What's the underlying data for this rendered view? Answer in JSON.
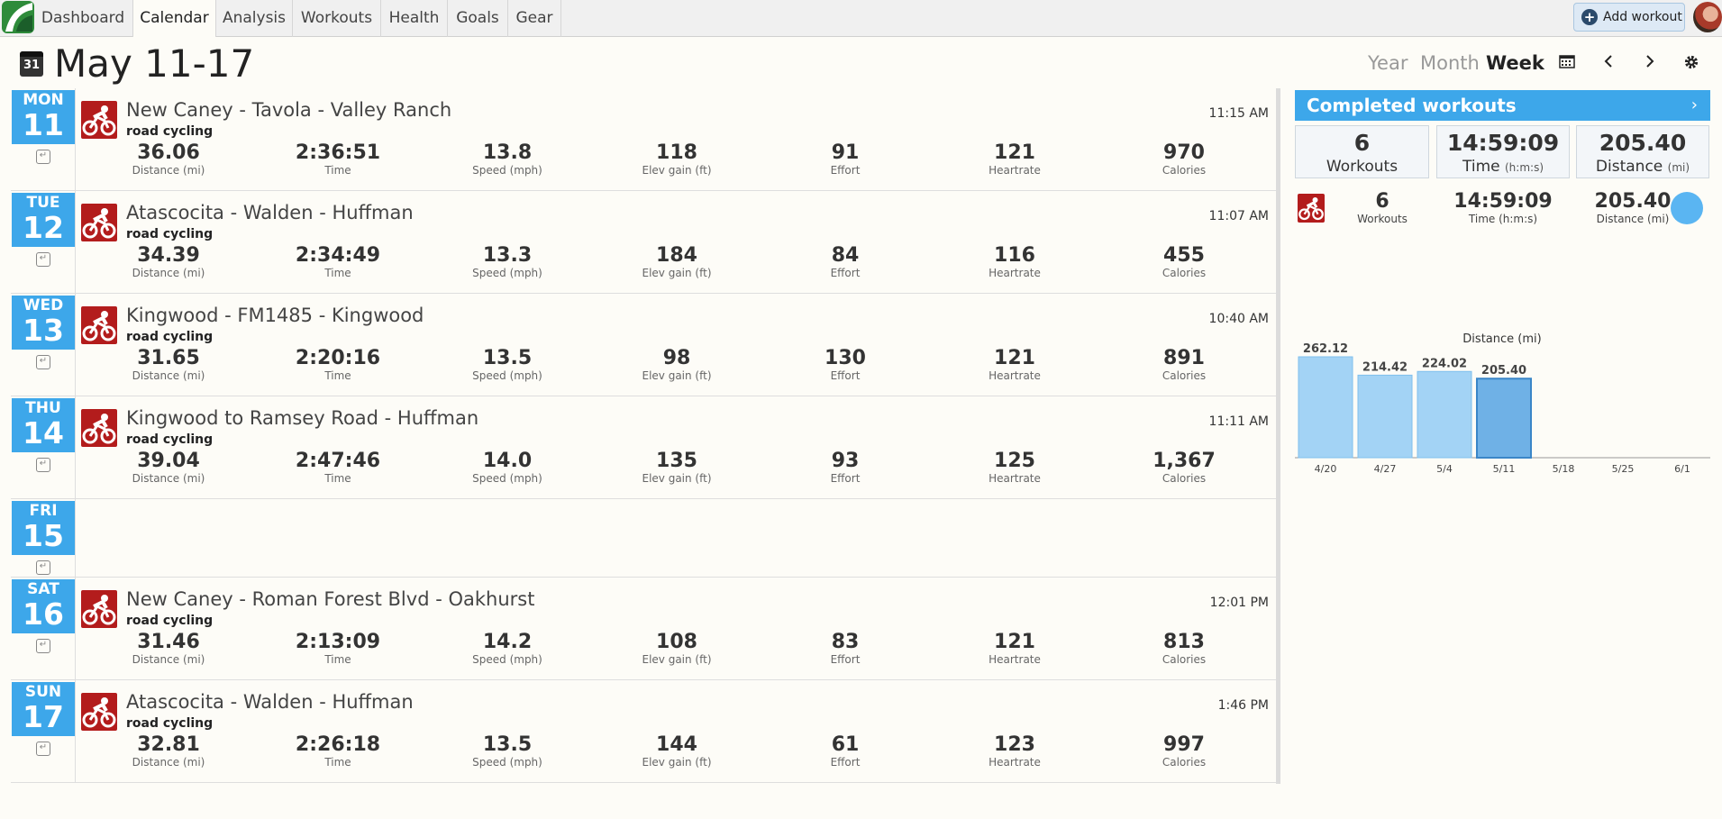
{
  "nav": {
    "tabs": [
      "Dashboard",
      "Calendar",
      "Analysis",
      "Workouts",
      "Health",
      "Goals",
      "Gear"
    ],
    "active": "Calendar",
    "add_workout": "Add workout"
  },
  "header": {
    "calendar_icon_text": "31",
    "title": "May 11-17",
    "views": [
      "Year",
      "Month",
      "Week"
    ],
    "active_view": "Week"
  },
  "icons": {
    "calendar_picker": "calendar-grid-icon",
    "prev": "chevron-left-icon",
    "next": "chevron-right-icon",
    "settings": "gear-icon",
    "workout_type": "road-cycling-icon",
    "day_add": "shoe-icon"
  },
  "colors": {
    "accent": "#3da7ea",
    "cycling": "#b31c1c",
    "bar": "#a3d3f5",
    "bar_current": "#6fb1e6"
  },
  "days": [
    {
      "dow": "MON",
      "num": "11",
      "workout": {
        "title": "New Caney - Tavola - Valley Ranch",
        "time_of_day": "11:15 AM",
        "type": "road cycling",
        "stats": [
          {
            "value": "36.06",
            "label": "Distance (mi)"
          },
          {
            "value": "2:36:51",
            "label": "Time"
          },
          {
            "value": "13.8",
            "label": "Speed (mph)"
          },
          {
            "value": "118",
            "label": "Elev gain (ft)"
          },
          {
            "value": "91",
            "label": "Effort"
          },
          {
            "value": "121",
            "label": "Heartrate"
          },
          {
            "value": "970",
            "label": "Calories"
          }
        ]
      }
    },
    {
      "dow": "TUE",
      "num": "12",
      "workout": {
        "title": "Atascocita - Walden - Huffman",
        "time_of_day": "11:07 AM",
        "type": "road cycling",
        "stats": [
          {
            "value": "34.39",
            "label": "Distance (mi)"
          },
          {
            "value": "2:34:49",
            "label": "Time"
          },
          {
            "value": "13.3",
            "label": "Speed (mph)"
          },
          {
            "value": "184",
            "label": "Elev gain (ft)"
          },
          {
            "value": "84",
            "label": "Effort"
          },
          {
            "value": "116",
            "label": "Heartrate"
          },
          {
            "value": "455",
            "label": "Calories"
          }
        ]
      }
    },
    {
      "dow": "WED",
      "num": "13",
      "workout": {
        "title": "Kingwood - FM1485 - Kingwood",
        "time_of_day": "10:40 AM",
        "type": "road cycling",
        "stats": [
          {
            "value": "31.65",
            "label": "Distance (mi)"
          },
          {
            "value": "2:20:16",
            "label": "Time"
          },
          {
            "value": "13.5",
            "label": "Speed (mph)"
          },
          {
            "value": "98",
            "label": "Elev gain (ft)"
          },
          {
            "value": "130",
            "label": "Effort"
          },
          {
            "value": "121",
            "label": "Heartrate"
          },
          {
            "value": "891",
            "label": "Calories"
          }
        ]
      }
    },
    {
      "dow": "THU",
      "num": "14",
      "workout": {
        "title": "Kingwood to Ramsey Road - Huffman",
        "time_of_day": "11:11 AM",
        "type": "road cycling",
        "stats": [
          {
            "value": "39.04",
            "label": "Distance (mi)"
          },
          {
            "value": "2:47:46",
            "label": "Time"
          },
          {
            "value": "14.0",
            "label": "Speed (mph)"
          },
          {
            "value": "135",
            "label": "Elev gain (ft)"
          },
          {
            "value": "93",
            "label": "Effort"
          },
          {
            "value": "125",
            "label": "Heartrate"
          },
          {
            "value": "1,367",
            "label": "Calories"
          }
        ]
      }
    },
    {
      "dow": "FRI",
      "num": "15",
      "workout": null
    },
    {
      "dow": "SAT",
      "num": "16",
      "workout": {
        "title": "New Caney - Roman Forest Blvd - Oakhurst",
        "time_of_day": "12:01 PM",
        "type": "road cycling",
        "stats": [
          {
            "value": "31.46",
            "label": "Distance (mi)"
          },
          {
            "value": "2:13:09",
            "label": "Time"
          },
          {
            "value": "14.2",
            "label": "Speed (mph)"
          },
          {
            "value": "108",
            "label": "Elev gain (ft)"
          },
          {
            "value": "83",
            "label": "Effort"
          },
          {
            "value": "121",
            "label": "Heartrate"
          },
          {
            "value": "813",
            "label": "Calories"
          }
        ]
      }
    },
    {
      "dow": "SUN",
      "num": "17",
      "workout": {
        "title": "Atascocita - Walden - Huffman",
        "time_of_day": "1:46 PM",
        "type": "road cycling",
        "stats": [
          {
            "value": "32.81",
            "label": "Distance (mi)"
          },
          {
            "value": "2:26:18",
            "label": "Time"
          },
          {
            "value": "13.5",
            "label": "Speed (mph)"
          },
          {
            "value": "144",
            "label": "Elev gain (ft)"
          },
          {
            "value": "61",
            "label": "Effort"
          },
          {
            "value": "123",
            "label": "Heartrate"
          },
          {
            "value": "997",
            "label": "Calories"
          }
        ]
      }
    }
  ],
  "summary": {
    "title": "Completed workouts",
    "boxes": [
      {
        "value": "6",
        "label": "Workouts",
        "unit": ""
      },
      {
        "value": "14:59:09",
        "label": "Time",
        "unit": "(h:m:s)"
      },
      {
        "value": "205.40",
        "label": "Distance",
        "unit": "(mi)"
      }
    ],
    "by_type": [
      {
        "value": "6",
        "label": "Workouts"
      },
      {
        "value": "14:59:09",
        "label": "Time (h:m:s)"
      },
      {
        "value": "205.40",
        "label": "Distance (mi)"
      }
    ]
  },
  "chart_data": {
    "type": "bar",
    "title": "Distance (mi)",
    "categories": [
      "4/20",
      "4/27",
      "5/4",
      "5/11",
      "5/18",
      "5/25",
      "6/1"
    ],
    "values": [
      262.12,
      214.42,
      224.02,
      205.4,
      null,
      null,
      null
    ],
    "labels": [
      "262.12",
      "214.42",
      "224.02",
      "205.40",
      "",
      "",
      ""
    ],
    "highlight_index": 3,
    "ylim": [
      0,
      262.12
    ]
  }
}
